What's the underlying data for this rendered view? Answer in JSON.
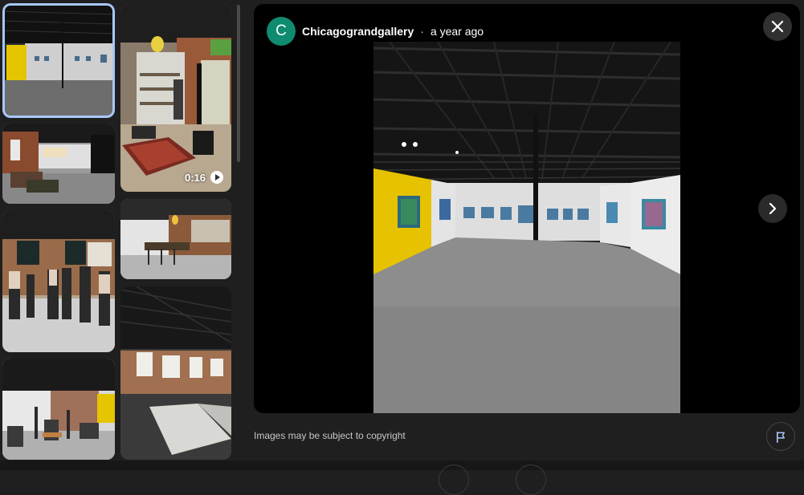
{
  "viewer": {
    "author_initial": "C",
    "author_name": "Chicagograndgallery",
    "separator": "·",
    "posted_time": "a year ago",
    "close_icon": "close-icon",
    "next_icon": "chevron-right-icon",
    "accent_avatar": "#0f8b6f"
  },
  "thumbnails": {
    "video_duration": "0:16",
    "selected_index": 0,
    "selected_color": "#a8c7fa"
  },
  "footer": {
    "copyright_notice": "Images may be subject to copyright",
    "flag_icon": "flag-icon"
  }
}
